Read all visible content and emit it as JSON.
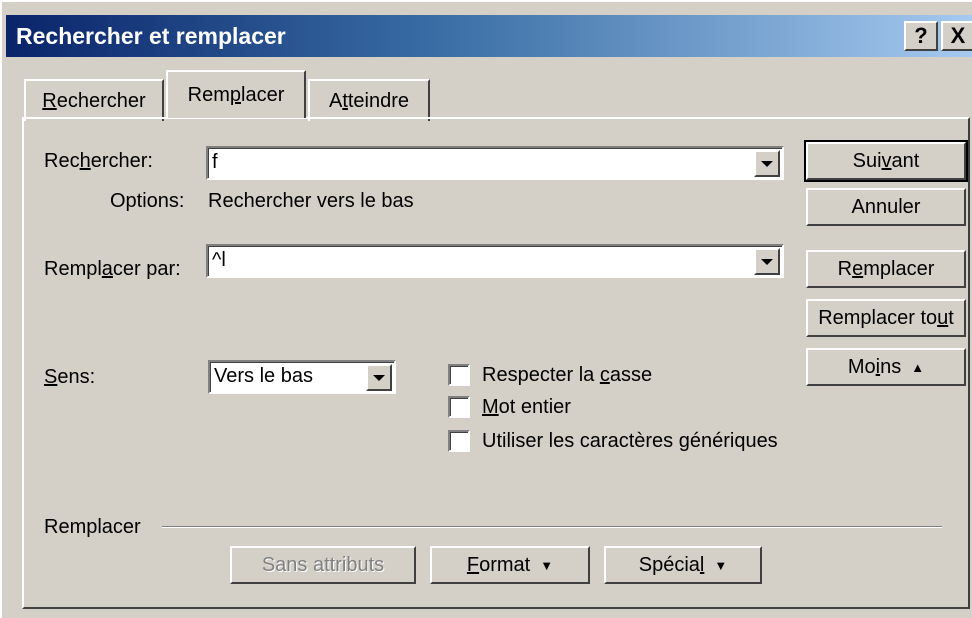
{
  "window": {
    "title": "Rechercher et remplacer",
    "help_label": "?",
    "close_label": "X"
  },
  "tabs": [
    {
      "pre": "",
      "u": "R",
      "post": "echercher"
    },
    {
      "pre": "Rem",
      "u": "p",
      "post": "lacer"
    },
    {
      "pre": "A",
      "u": "t",
      "post": "teindre"
    }
  ],
  "find": {
    "label_pre": "Rec",
    "label_u": "h",
    "label_post": "ercher:",
    "value": "f"
  },
  "options": {
    "label": "Options:",
    "value": "Rechercher vers le bas"
  },
  "replace": {
    "label_pre": "Rempl",
    "label_u": "a",
    "label_post": "cer par:",
    "value": "^l"
  },
  "direction": {
    "label_u": "S",
    "label_post": "ens:",
    "value": "Vers le bas"
  },
  "checkboxes": [
    {
      "pre": "Respecter la ",
      "u": "c",
      "post": "asse",
      "checked": false
    },
    {
      "pre": "",
      "u": "M",
      "post": "ot entier",
      "checked": false
    },
    {
      "pre": "Utiliser les caractères ",
      "u": "g",
      "post": "énériques",
      "checked": false
    }
  ],
  "side_buttons": {
    "next": {
      "pre": "Sui",
      "u": "v",
      "post": "ant"
    },
    "cancel": {
      "label": "Annuler"
    },
    "replace": {
      "pre": "R",
      "u": "e",
      "post": "mplacer"
    },
    "replace_all": {
      "pre": "Remplacer to",
      "u": "u",
      "post": "t"
    },
    "less": {
      "pre": "Mo",
      "u": "i",
      "post": "ns",
      "arrow": "▲"
    }
  },
  "group": {
    "label": "Remplacer"
  },
  "bottom_buttons": {
    "no_format": {
      "label": "Sans attributs"
    },
    "format": {
      "pre": "",
      "u": "F",
      "post": "ormat",
      "arrow": "▼"
    },
    "special": {
      "pre": "Spécia",
      "u": "l",
      "post": "",
      "arrow": "▼"
    }
  }
}
